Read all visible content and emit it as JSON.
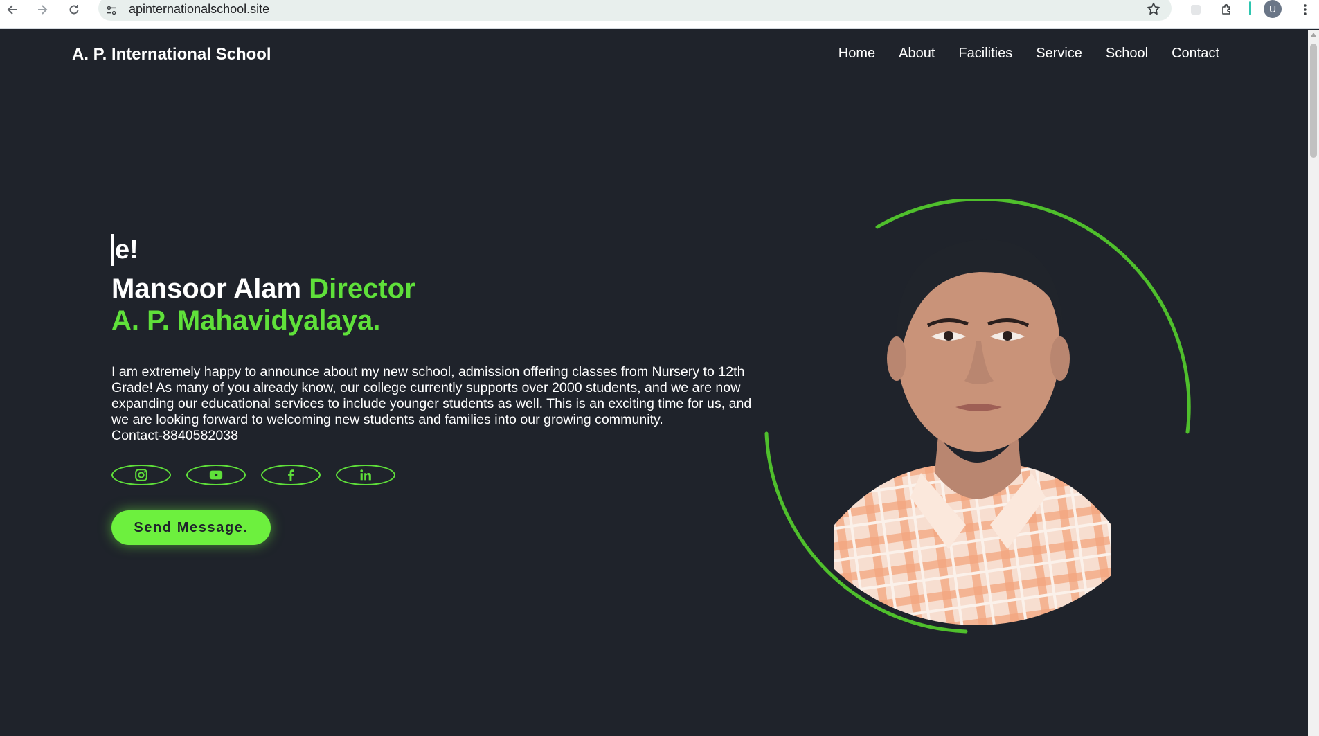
{
  "browser": {
    "url": "apinternationalschool.site",
    "profile_initial": "U",
    "icons": [
      "back-arrow-icon",
      "forward-arrow-icon",
      "reload-icon",
      "site-info-icon",
      "bookmark-star-icon",
      "extension-icon",
      "puzzle-icon",
      "more-menu-icon"
    ]
  },
  "header": {
    "brand": "A. P. International School",
    "nav": [
      "Home",
      "About",
      "Facilities",
      "Service",
      "School",
      "Contact"
    ]
  },
  "hero": {
    "typed_text": "e!",
    "name": "Mansoor Alam",
    "title_part1": "Director",
    "title_part2": "A. P. Mahavidyalaya.",
    "bio": "I am extremely happy to announce about my new school, admission offering classes from Nursery to 12th Grade! As many of you already know, our college currently supports over 2000 students, and we are now expanding our educational services to include younger students as well. This is an exciting time for us, and we are looking forward to welcoming new students and families into our growing community.",
    "contact": "Contact-8840582038",
    "socials": [
      "instagram-icon",
      "youtube-icon",
      "facebook-icon",
      "linkedin-icon"
    ],
    "cta": "Send Message."
  },
  "colors": {
    "background": "#1f232b",
    "accent": "#5fe03a",
    "button": "#6df03e",
    "text": "#ffffff"
  }
}
